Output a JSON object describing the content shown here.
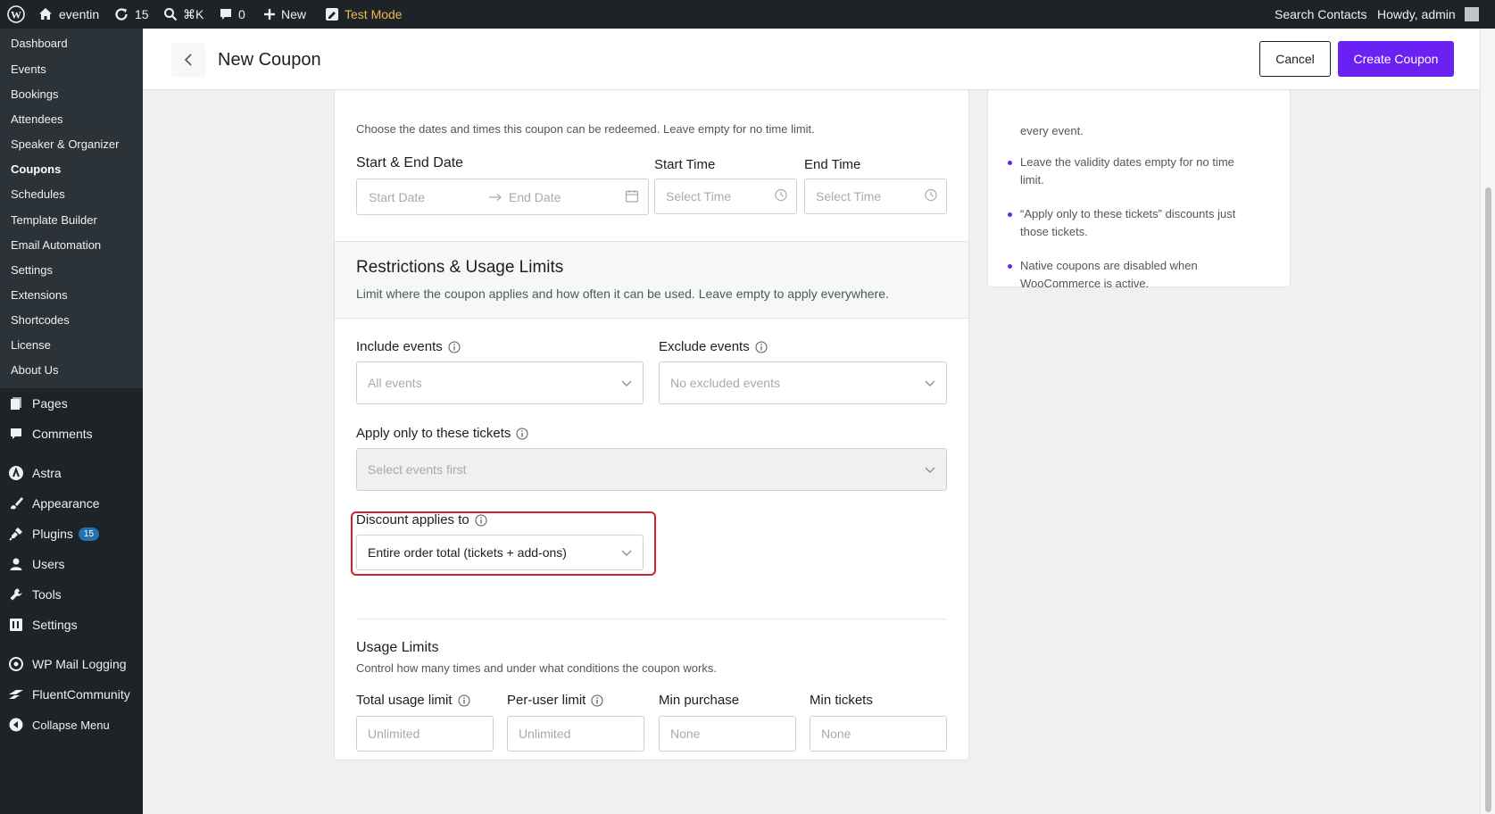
{
  "adminbar": {
    "site_name": "eventin",
    "updates_count": "15",
    "search_shortcut": "⌘K",
    "comments_count": "0",
    "new_label": "New",
    "test_mode_label": "Test Mode",
    "search_contacts": "Search Contacts",
    "howdy": "Howdy, admin"
  },
  "sidebar": {
    "submenu": [
      "Dashboard",
      "Events",
      "Bookings",
      "Attendees",
      "Speaker & Organizer",
      "Coupons",
      "Schedules",
      "Template Builder",
      "Email Automation",
      "Settings",
      "Extensions",
      "Shortcodes",
      "License",
      "About Us"
    ],
    "current_submenu": "Coupons",
    "menu": {
      "pages": "Pages",
      "comments": "Comments",
      "astra": "Astra",
      "appearance": "Appearance",
      "plugins": "Plugins",
      "plugins_badge": "15",
      "users": "Users",
      "tools": "Tools",
      "settings": "Settings",
      "wp_mail_logging": "WP Mail Logging",
      "fluent_community": "FluentCommunity",
      "collapse": "Collapse Menu"
    }
  },
  "header": {
    "title": "New Coupon",
    "cancel_label": "Cancel",
    "create_label": "Create Coupon"
  },
  "validity": {
    "description": "Choose the dates and times this coupon can be redeemed. Leave empty for no time limit.",
    "date_label": "Start & End Date",
    "start_date_placeholder": "Start Date",
    "end_date_placeholder": "End Date",
    "start_time_label": "Start Time",
    "start_time_placeholder": "Select Time",
    "end_time_label": "End Time",
    "end_time_placeholder": "Select Time"
  },
  "restrictions": {
    "title": "Restrictions & Usage Limits",
    "description": "Limit where the coupon applies and how often it can be used. Leave empty to apply everywhere.",
    "include_label": "Include events",
    "include_placeholder": "All events",
    "exclude_label": "Exclude events",
    "exclude_placeholder": "No excluded events",
    "tickets_label": "Apply only to these tickets",
    "tickets_placeholder": "Select events first",
    "discount_label": "Discount applies to",
    "discount_value": "Entire order total (tickets + add-ons)"
  },
  "usage": {
    "title": "Usage Limits",
    "description": "Control how many times and under what conditions the coupon works.",
    "total_label": "Total usage limit",
    "total_placeholder": "Unlimited",
    "per_user_label": "Per-user limit",
    "per_user_placeholder": "Unlimited",
    "min_purchase_label": "Min purchase",
    "min_purchase_placeholder": "None",
    "min_tickets_label": "Min tickets",
    "min_tickets_placeholder": "None"
  },
  "tips": {
    "partial": "every event.",
    "items": [
      "Leave the validity dates empty for no time limit.",
      "“Apply only to these tickets” discounts just those tickets.",
      "Native coupons are disabled when WooCommerce is active."
    ]
  },
  "colors": {
    "accent": "#6b21f2",
    "highlight": "#d0232f",
    "adminbar_bg": "#1d2327",
    "submenu_bg": "#2c3338",
    "test_mode": "#f0b849"
  }
}
